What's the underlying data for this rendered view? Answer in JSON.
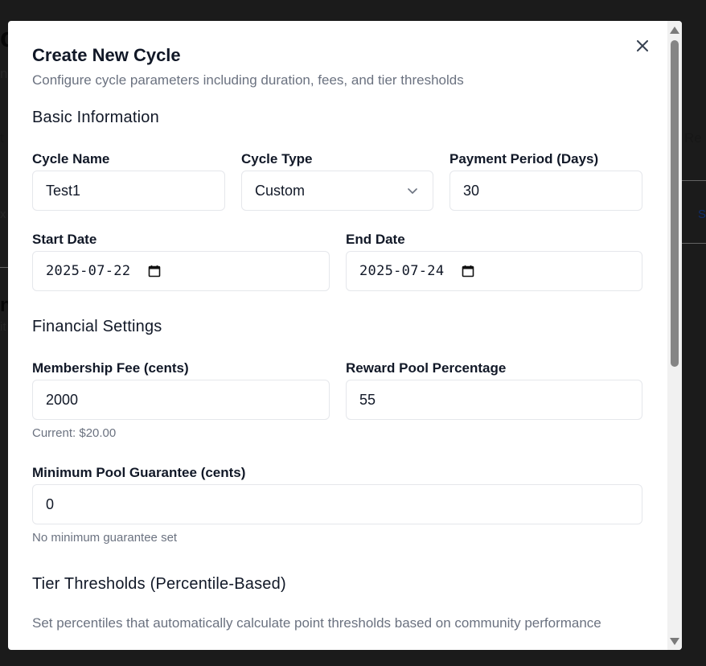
{
  "modal": {
    "title": "Create New Cycle",
    "subtitle": "Configure cycle parameters including duration, fees, and tier thresholds"
  },
  "sections": {
    "basic": "Basic Information",
    "financial": "Financial Settings",
    "tiers": "Tier Thresholds (Percentile-Based)"
  },
  "fields": {
    "cycle_name": {
      "label": "Cycle Name",
      "value": "Test1"
    },
    "cycle_type": {
      "label": "Cycle Type",
      "value": "Custom"
    },
    "payment_period": {
      "label": "Payment Period (Days)",
      "value": "30"
    },
    "start_date": {
      "label": "Start Date",
      "value": "2025-07-22"
    },
    "end_date": {
      "label": "End Date",
      "value": "2025-07-24"
    },
    "membership_fee": {
      "label": "Membership Fee (cents)",
      "value": "2000",
      "hint": "Current: $20.00"
    },
    "reward_pool": {
      "label": "Reward Pool Percentage",
      "value": "55"
    },
    "min_pool": {
      "label": "Minimum Pool Guarantee (cents)",
      "value": "0",
      "hint": "No minimum guarantee set"
    }
  },
  "tiers_description": "Set percentiles that automatically calculate point thresholds based on community performance",
  "colors": {
    "backdrop": "#3d3d3d",
    "modal_bg": "#ffffff",
    "muted_text": "#6b7280",
    "border": "#e5e7eb"
  },
  "icons": {
    "close": "close-icon",
    "chevron": "chevron-down-icon",
    "calendar": "calendar-icon"
  }
}
